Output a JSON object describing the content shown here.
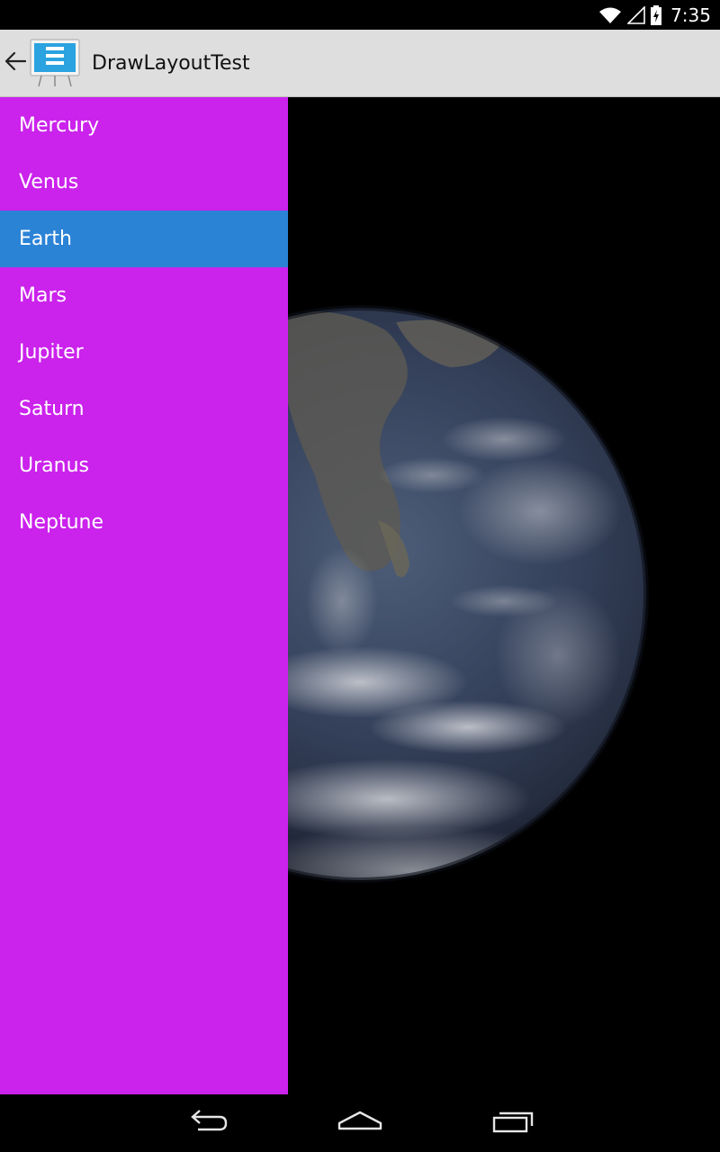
{
  "status_bar": {
    "time": "7:35",
    "icons": [
      "wifi-icon",
      "signal-icon",
      "battery-charging-icon"
    ]
  },
  "action_bar": {
    "title": "DrawLayoutTest",
    "up_icon": "arrow-left-icon",
    "app_icon": "presentation-board-icon"
  },
  "drawer": {
    "items": [
      {
        "label": "Mercury"
      },
      {
        "label": "Venus"
      },
      {
        "label": "Earth"
      },
      {
        "label": "Mars"
      },
      {
        "label": "Jupiter"
      },
      {
        "label": "Saturn"
      },
      {
        "label": "Uranus"
      },
      {
        "label": "Neptune"
      }
    ],
    "selected_index": 2
  },
  "content": {
    "image": "earth-image"
  },
  "nav_bar": {
    "buttons": [
      "back-icon",
      "home-icon",
      "recents-icon"
    ]
  },
  "colors": {
    "drawer_background": "#cb22ec",
    "selected_item": "#2b83d6",
    "action_bar": "#dedede",
    "status_bar": "#000000"
  }
}
